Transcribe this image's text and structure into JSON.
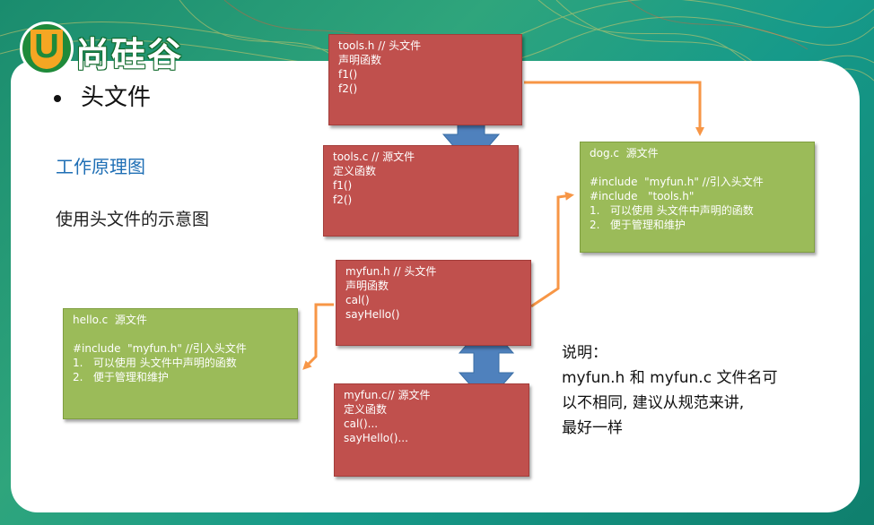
{
  "logo": {
    "letter": "U",
    "text": "尚硅谷"
  },
  "bullet": "头文件",
  "subtitle": "工作原理图",
  "description": "使用头文件的示意图",
  "boxes": {
    "tools_h": {
      "lines": [
        "tools.h // 头文件",
        "声明函数",
        "f1()",
        "f2()"
      ],
      "color": "#c0504d"
    },
    "tools_c": {
      "lines": [
        "tools.c // 源文件",
        "定义函数",
        "f1()",
        "f2()"
      ],
      "color": "#c0504d"
    },
    "dog_c": {
      "title": "dog.c  源文件",
      "lines": [
        "#include  \"myfun.h\" //引入头文件",
        "#include   \"tools.h\"",
        "1.   可以使用 头文件中声明的函数",
        "2.   便于管理和维护"
      ],
      "color": "#9bbb59"
    },
    "myfun_h": {
      "lines": [
        "myfun.h // 头文件",
        "声明函数",
        "cal()",
        "sayHello()"
      ],
      "color": "#c0504d"
    },
    "hello_c": {
      "title": "hello.c  源文件",
      "lines": [
        "#include  \"myfun.h\" //引入头文件",
        "1.   可以使用 头文件中声明的函数",
        "2.   便于管理和维护"
      ],
      "color": "#9bbb59"
    },
    "myfun_c": {
      "lines": [
        "myfun.c// 源文件",
        "定义函数",
        "cal()...",
        "sayHello()..."
      ],
      "color": "#c0504d"
    }
  },
  "note": {
    "lines": [
      "说明：",
      "myfun.h 和 myfun.c 文件名可",
      "以不相同, 建议从规范来讲,",
      "最好一样"
    ]
  },
  "colors": {
    "arrow_orange": "#f79646",
    "arrow_blue": "#4f81bd"
  }
}
